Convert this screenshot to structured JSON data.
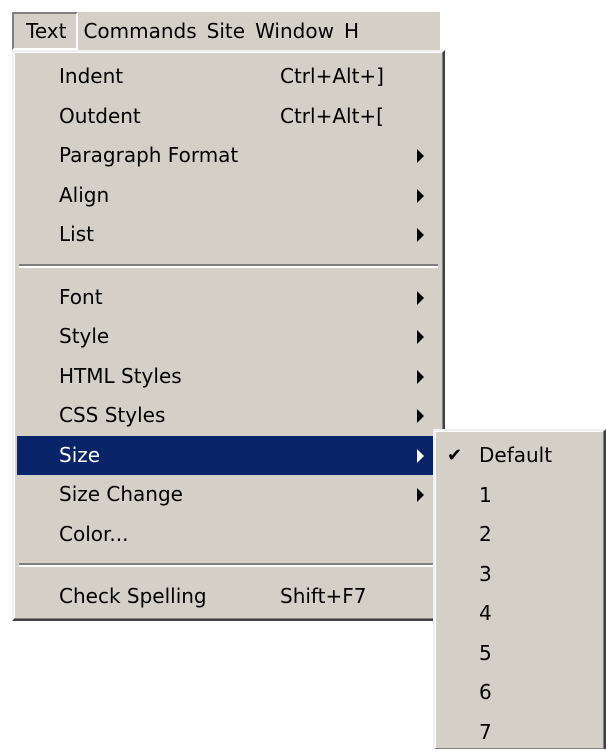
{
  "menubar": {
    "items": [
      "Text",
      "Commands",
      "Site",
      "Window",
      "H"
    ]
  },
  "text_menu": {
    "group1": [
      {
        "label": "Indent",
        "shortcut": "Ctrl+Alt+]"
      },
      {
        "label": "Outdent",
        "shortcut": "Ctrl+Alt+["
      },
      {
        "label": "Paragraph Format"
      },
      {
        "label": "Align"
      },
      {
        "label": "List"
      }
    ],
    "group2": [
      {
        "label": "Font"
      },
      {
        "label": "Style"
      },
      {
        "label": "HTML Styles"
      },
      {
        "label": "CSS Styles"
      },
      {
        "label": "Size"
      },
      {
        "label": "Size Change"
      },
      {
        "label": "Color..."
      }
    ],
    "group3": [
      {
        "label": "Check Spelling",
        "shortcut": "Shift+F7"
      }
    ]
  },
  "size_menu": {
    "checkmark": "✔",
    "items": [
      "Default",
      "1",
      "2",
      "3",
      "4",
      "5",
      "6",
      "7"
    ]
  },
  "colors": {
    "menu_bg": "#d4d0c8",
    "highlight": "#0a246a"
  }
}
